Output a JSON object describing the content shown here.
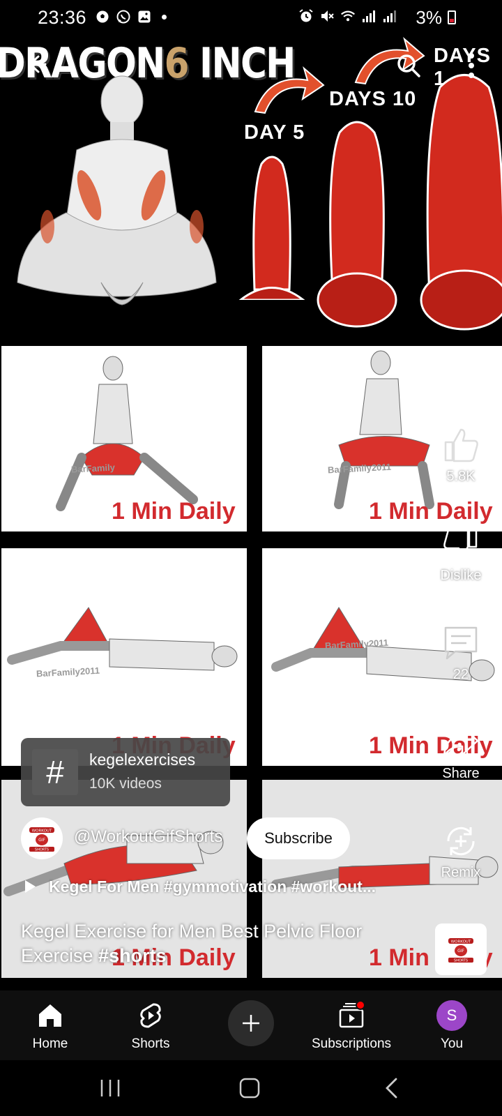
{
  "status_bar": {
    "time": "23:36",
    "battery": "3%",
    "left_icons": [
      "soccer-ball-icon",
      "whatsapp-icon",
      "gallery-icon",
      "dot-icon"
    ],
    "right_icons": [
      "alarm-icon",
      "mute-icon",
      "wifi-icon",
      "signal-icon",
      "signal-icon",
      "battery-icon"
    ]
  },
  "top_bar": {
    "icons": [
      "back-arrow-icon",
      "search-icon",
      "more-vertical-icon"
    ]
  },
  "artwork": {
    "headline_left": "DRAGON",
    "headline_num": "6",
    "headline_right": "INCH",
    "day_labels": [
      "DAY 5",
      "DAYS 10",
      "DAYS 1"
    ],
    "captions": [
      "1 Min Daily",
      "1 Min Daily",
      "1 Min Daily",
      "1 Min Daily",
      "1 Min Daily",
      "1 Min Daily"
    ],
    "watermarks": [
      "BarFamily",
      "BarFamily2011",
      "BarFamily2011",
      "BarFamily2011"
    ],
    "accent_red": "#d22a2e",
    "muscle_red": "#d9322c"
  },
  "actions": {
    "like_count": "5.8K",
    "dislike_label": "Dislike",
    "comment_count": "22",
    "share_label": "Share",
    "remix_label": "Remix"
  },
  "hashtag_chip": {
    "tag": "kegelexercises",
    "count": "10K videos"
  },
  "channel": {
    "handle": "@WorkoutGifShorts",
    "subscribe_label": "Subscribe",
    "logo_text": [
      "WORKOUT",
      "GIF",
      "SHORTS"
    ]
  },
  "music": {
    "text": "Kegel For Men  #gymmotivation #workout..."
  },
  "video": {
    "title_plain": "Kegel Exercise for Men Best Pelvic Floor Exercise ",
    "title_tag": "#shorts"
  },
  "bottom_nav": {
    "home": "Home",
    "shorts": "Shorts",
    "subscriptions": "Subscriptions",
    "you": "You",
    "you_initial": "S"
  },
  "system_nav": {
    "icons": [
      "recents-icon",
      "home-icon",
      "back-icon"
    ]
  }
}
